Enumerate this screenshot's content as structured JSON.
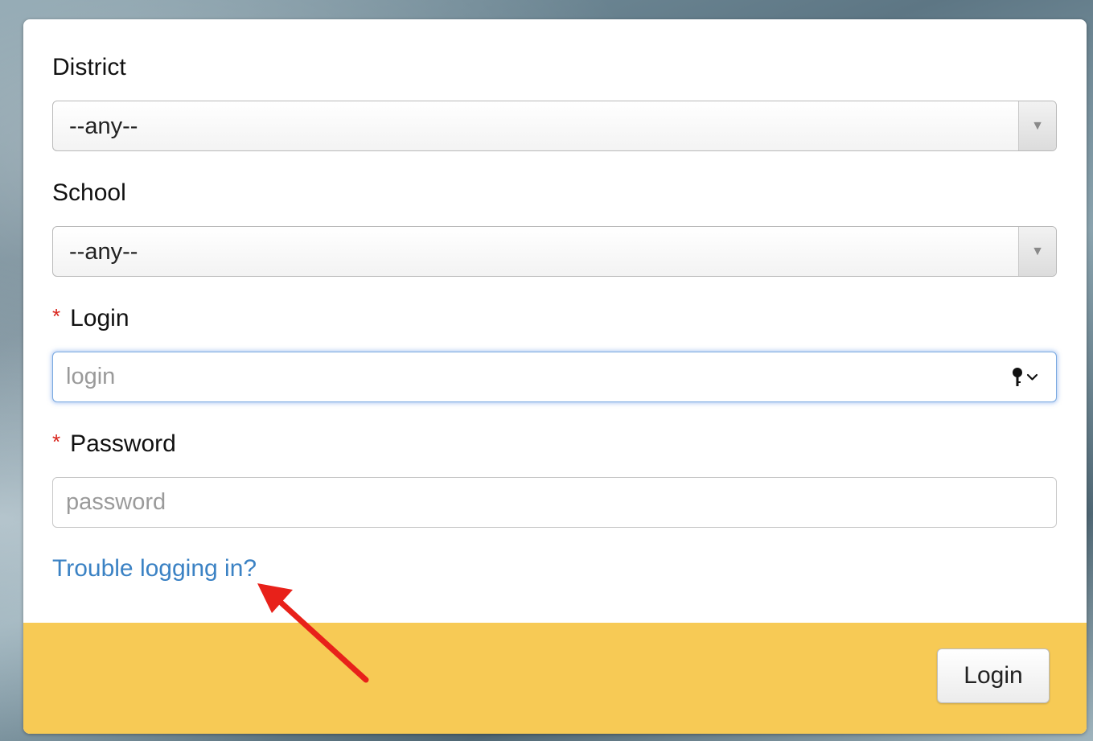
{
  "form": {
    "district": {
      "label": "District",
      "selected": "--any--"
    },
    "school": {
      "label": "School",
      "selected": "--any--"
    },
    "login": {
      "required_mark": "*",
      "label": "Login",
      "placeholder": "login",
      "value": ""
    },
    "password": {
      "required_mark": "*",
      "label": "Password",
      "placeholder": "password",
      "value": ""
    },
    "trouble_link": "Trouble logging in?",
    "submit_label": "Login"
  },
  "icons": {
    "select_arrow": "dropdown-arrow-icon",
    "key": "key-icon",
    "chevron": "chevron-down-icon",
    "annotation": "annotation-arrow"
  },
  "colors": {
    "footer": "#f7ca55",
    "link": "#3b82c4",
    "required": "#d9251d",
    "annotation": "#e8211a",
    "focus": "#79a9e0"
  }
}
